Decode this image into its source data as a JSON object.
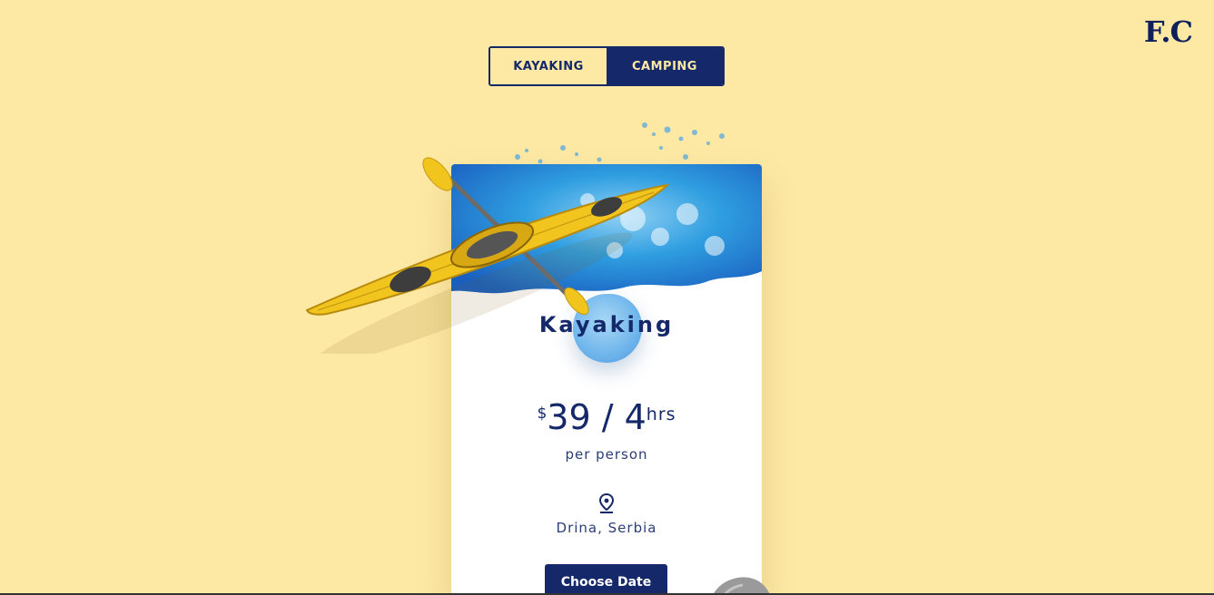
{
  "brand": {
    "logo": "F.C"
  },
  "tabs": [
    {
      "label": "KAYAKING",
      "active": true
    },
    {
      "label": "CAMPING",
      "active": false
    }
  ],
  "card": {
    "title": "Kayaking",
    "price": {
      "currency": "$",
      "amount": "39 / 4",
      "unit": "hrs"
    },
    "per_label": "per person",
    "location_icon": "location-pin-icon",
    "location": "Drina, Serbia",
    "cta_label": "Choose Date"
  },
  "colors": {
    "background": "#fde9a4",
    "navy": "#14286a",
    "kayak_yellow": "#f2c41e",
    "water_blue": "#2f9ee0"
  }
}
